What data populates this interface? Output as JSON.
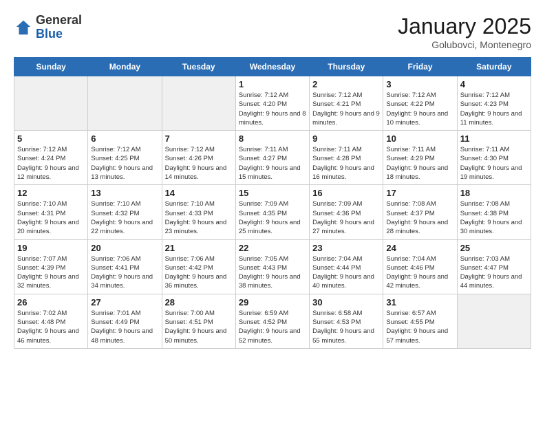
{
  "header": {
    "logo_line1": "General",
    "logo_line2": "Blue",
    "month": "January 2025",
    "location": "Golubovci, Montenegro"
  },
  "day_headers": [
    "Sunday",
    "Monday",
    "Tuesday",
    "Wednesday",
    "Thursday",
    "Friday",
    "Saturday"
  ],
  "weeks": [
    [
      {
        "day": "",
        "text": "",
        "shaded": true
      },
      {
        "day": "",
        "text": "",
        "shaded": true
      },
      {
        "day": "",
        "text": "",
        "shaded": true
      },
      {
        "day": "1",
        "text": "Sunrise: 7:12 AM\nSunset: 4:20 PM\nDaylight: 9 hours and 8 minutes."
      },
      {
        "day": "2",
        "text": "Sunrise: 7:12 AM\nSunset: 4:21 PM\nDaylight: 9 hours and 9 minutes."
      },
      {
        "day": "3",
        "text": "Sunrise: 7:12 AM\nSunset: 4:22 PM\nDaylight: 9 hours and 10 minutes."
      },
      {
        "day": "4",
        "text": "Sunrise: 7:12 AM\nSunset: 4:23 PM\nDaylight: 9 hours and 11 minutes."
      }
    ],
    [
      {
        "day": "5",
        "text": "Sunrise: 7:12 AM\nSunset: 4:24 PM\nDaylight: 9 hours and 12 minutes."
      },
      {
        "day": "6",
        "text": "Sunrise: 7:12 AM\nSunset: 4:25 PM\nDaylight: 9 hours and 13 minutes."
      },
      {
        "day": "7",
        "text": "Sunrise: 7:12 AM\nSunset: 4:26 PM\nDaylight: 9 hours and 14 minutes."
      },
      {
        "day": "8",
        "text": "Sunrise: 7:11 AM\nSunset: 4:27 PM\nDaylight: 9 hours and 15 minutes."
      },
      {
        "day": "9",
        "text": "Sunrise: 7:11 AM\nSunset: 4:28 PM\nDaylight: 9 hours and 16 minutes."
      },
      {
        "day": "10",
        "text": "Sunrise: 7:11 AM\nSunset: 4:29 PM\nDaylight: 9 hours and 18 minutes."
      },
      {
        "day": "11",
        "text": "Sunrise: 7:11 AM\nSunset: 4:30 PM\nDaylight: 9 hours and 19 minutes."
      }
    ],
    [
      {
        "day": "12",
        "text": "Sunrise: 7:10 AM\nSunset: 4:31 PM\nDaylight: 9 hours and 20 minutes."
      },
      {
        "day": "13",
        "text": "Sunrise: 7:10 AM\nSunset: 4:32 PM\nDaylight: 9 hours and 22 minutes."
      },
      {
        "day": "14",
        "text": "Sunrise: 7:10 AM\nSunset: 4:33 PM\nDaylight: 9 hours and 23 minutes."
      },
      {
        "day": "15",
        "text": "Sunrise: 7:09 AM\nSunset: 4:35 PM\nDaylight: 9 hours and 25 minutes."
      },
      {
        "day": "16",
        "text": "Sunrise: 7:09 AM\nSunset: 4:36 PM\nDaylight: 9 hours and 27 minutes."
      },
      {
        "day": "17",
        "text": "Sunrise: 7:08 AM\nSunset: 4:37 PM\nDaylight: 9 hours and 28 minutes."
      },
      {
        "day": "18",
        "text": "Sunrise: 7:08 AM\nSunset: 4:38 PM\nDaylight: 9 hours and 30 minutes."
      }
    ],
    [
      {
        "day": "19",
        "text": "Sunrise: 7:07 AM\nSunset: 4:39 PM\nDaylight: 9 hours and 32 minutes."
      },
      {
        "day": "20",
        "text": "Sunrise: 7:06 AM\nSunset: 4:41 PM\nDaylight: 9 hours and 34 minutes."
      },
      {
        "day": "21",
        "text": "Sunrise: 7:06 AM\nSunset: 4:42 PM\nDaylight: 9 hours and 36 minutes."
      },
      {
        "day": "22",
        "text": "Sunrise: 7:05 AM\nSunset: 4:43 PM\nDaylight: 9 hours and 38 minutes."
      },
      {
        "day": "23",
        "text": "Sunrise: 7:04 AM\nSunset: 4:44 PM\nDaylight: 9 hours and 40 minutes."
      },
      {
        "day": "24",
        "text": "Sunrise: 7:04 AM\nSunset: 4:46 PM\nDaylight: 9 hours and 42 minutes."
      },
      {
        "day": "25",
        "text": "Sunrise: 7:03 AM\nSunset: 4:47 PM\nDaylight: 9 hours and 44 minutes."
      }
    ],
    [
      {
        "day": "26",
        "text": "Sunrise: 7:02 AM\nSunset: 4:48 PM\nDaylight: 9 hours and 46 minutes."
      },
      {
        "day": "27",
        "text": "Sunrise: 7:01 AM\nSunset: 4:49 PM\nDaylight: 9 hours and 48 minutes."
      },
      {
        "day": "28",
        "text": "Sunrise: 7:00 AM\nSunset: 4:51 PM\nDaylight: 9 hours and 50 minutes."
      },
      {
        "day": "29",
        "text": "Sunrise: 6:59 AM\nSunset: 4:52 PM\nDaylight: 9 hours and 52 minutes."
      },
      {
        "day": "30",
        "text": "Sunrise: 6:58 AM\nSunset: 4:53 PM\nDaylight: 9 hours and 55 minutes."
      },
      {
        "day": "31",
        "text": "Sunrise: 6:57 AM\nSunset: 4:55 PM\nDaylight: 9 hours and 57 minutes."
      },
      {
        "day": "",
        "text": "",
        "shaded": true
      }
    ]
  ]
}
